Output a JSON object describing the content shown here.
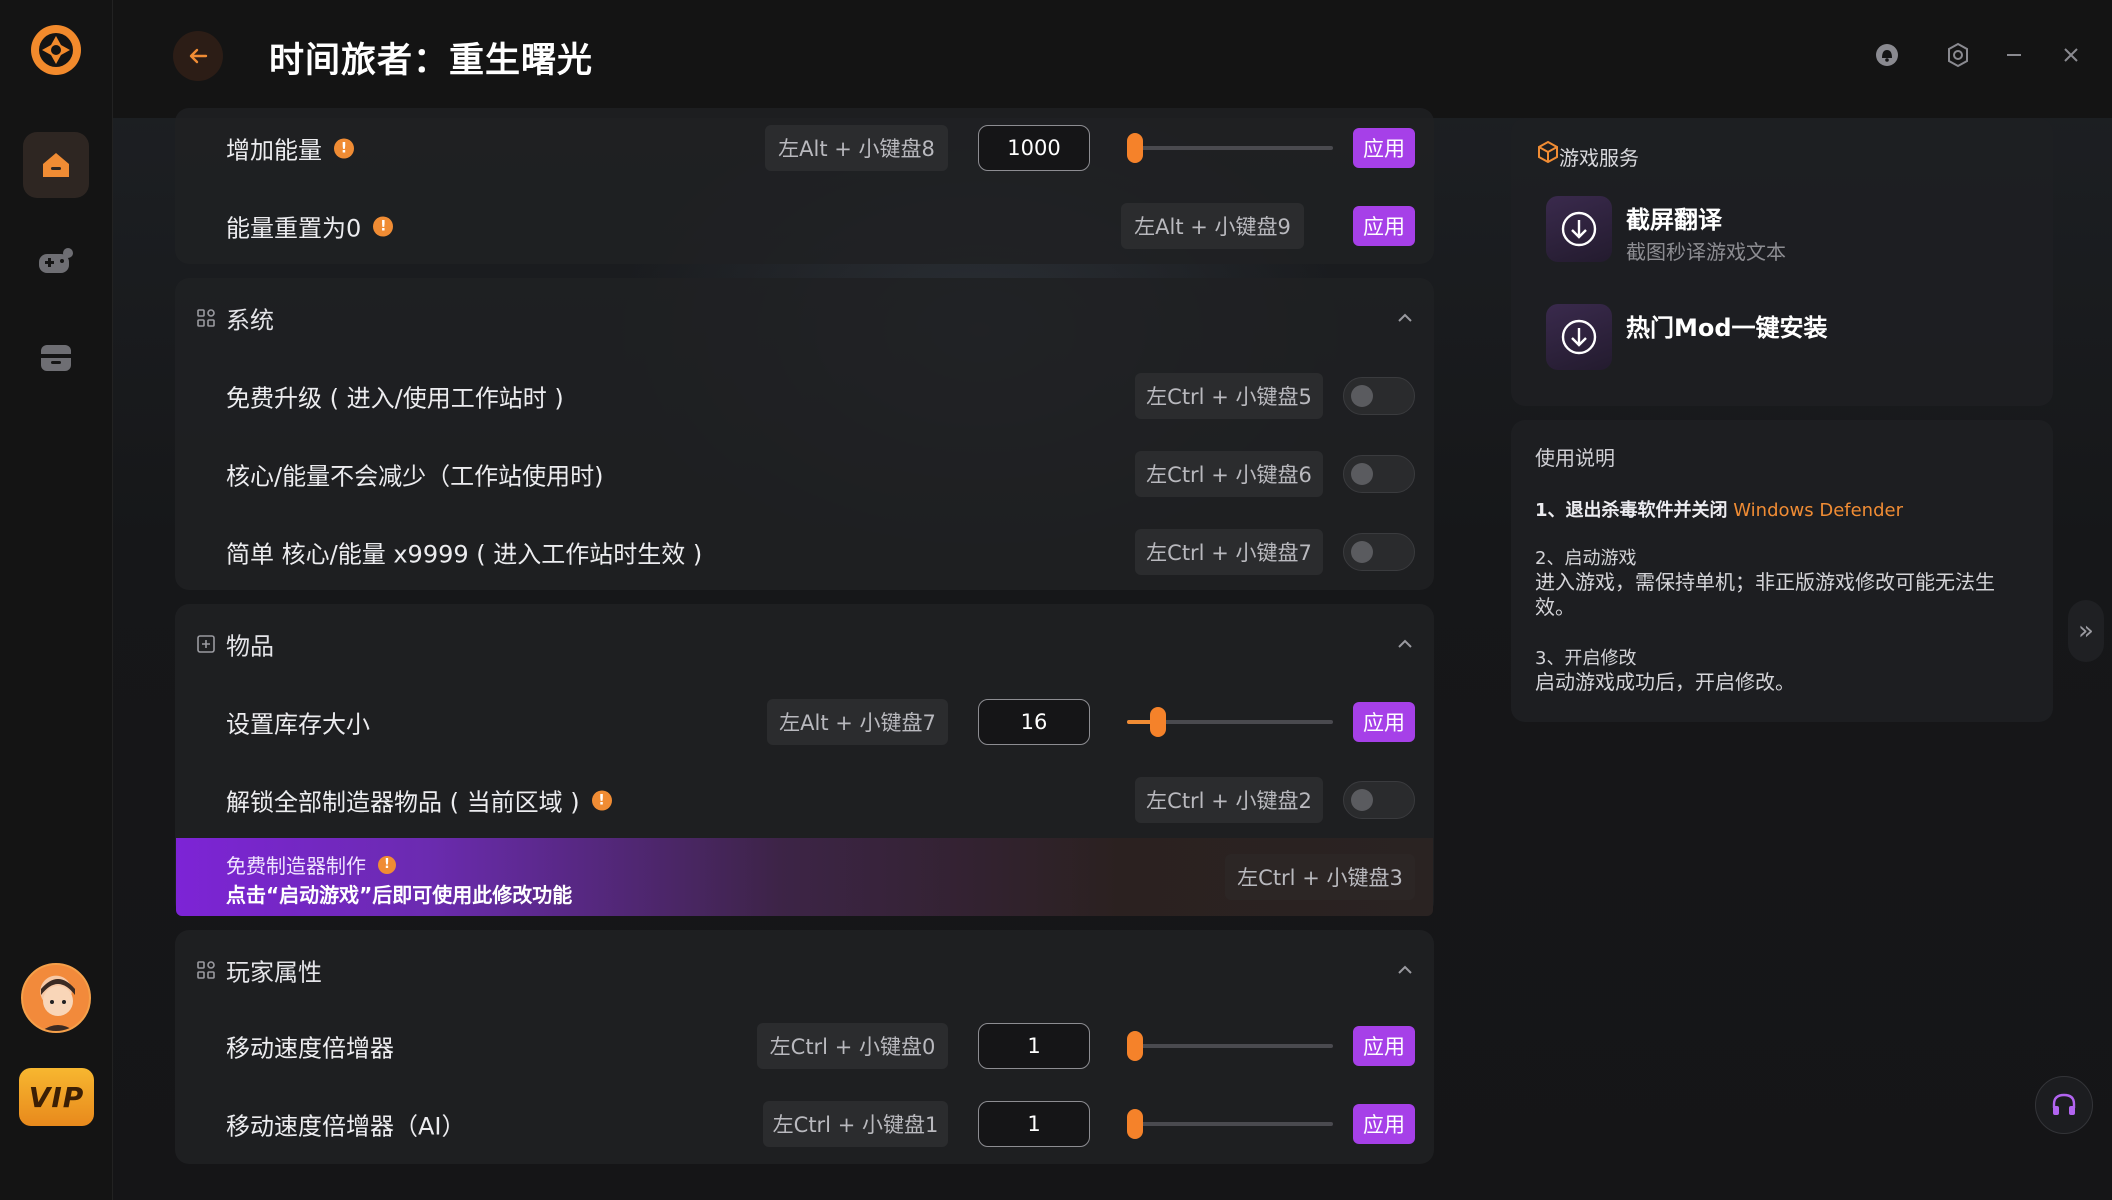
{
  "app": {
    "title": "时间旅者：重生曙光"
  },
  "sidebar": {
    "vip_label": "VIP"
  },
  "top_section": {
    "rows": [
      {
        "label": "增加能量",
        "hotkey": "左Alt + 小键盘8",
        "value": "1000",
        "slider_fraction": 0.0,
        "apply": "应用"
      },
      {
        "label": "能量重置为0",
        "hotkey": "左Alt + 小键盘9",
        "apply": "应用"
      }
    ]
  },
  "system_section": {
    "title": "系统",
    "rows": [
      {
        "label": "免费升级 ( 进入/使用工作站时 )",
        "hotkey": "左Ctrl + 小键盘5",
        "enabled": false
      },
      {
        "label": "核心/能量不会减少（工作站使用时)",
        "hotkey": "左Ctrl + 小键盘6",
        "enabled": false
      },
      {
        "label": "简单 核心/能量 x9999 ( 进入工作站时生效 )",
        "hotkey": "左Ctrl + 小键盘7",
        "enabled": false
      }
    ]
  },
  "items_section": {
    "title": "物品",
    "rows": [
      {
        "label": "设置库存大小",
        "hotkey": "左Alt + 小键盘7",
        "value": "16",
        "slider_fraction": 0.12,
        "apply": "应用"
      },
      {
        "label": "解锁全部制造器物品 ( 当前区域 )",
        "hotkey": "左Ctrl + 小键盘2",
        "enabled": false
      }
    ],
    "promo": {
      "line1": "免费制造器制作",
      "line2": "点击“启动游戏”后即可使用此修改功能",
      "hotkey": "左Ctrl + 小键盘3"
    }
  },
  "player_section": {
    "title": "玩家属性",
    "rows": [
      {
        "label": "移动速度倍增器",
        "hotkey": "左Ctrl + 小键盘0",
        "value": "1",
        "slider_fraction": 0.0,
        "apply": "应用"
      },
      {
        "label": "移动速度倍增器（AI）",
        "hotkey": "左Ctrl + 小键盘1",
        "value": "1",
        "slider_fraction": 0.0,
        "apply": "应用"
      }
    ]
  },
  "services": {
    "title": "游戏服务",
    "items": [
      {
        "name": "截屏翻译",
        "desc": "截图秒译游戏文本"
      },
      {
        "name": "热门Mod一键安装",
        "desc": ""
      }
    ]
  },
  "instructions": {
    "title": "使用说明",
    "step1_title": "1、退出杀毒软件并关闭",
    "step1_highlight": "Windows Defender",
    "step2_title": "2、启动游戏",
    "step2_text": "进入游戏，需保持单机；非正版游戏修改可能无法生效。",
    "step3_title": "3、开启修改",
    "step3_text": "启动游戏成功后，开启修改。"
  },
  "colors": {
    "accent": "#f08c34",
    "apply": "#a640e8",
    "background": "#161719"
  }
}
